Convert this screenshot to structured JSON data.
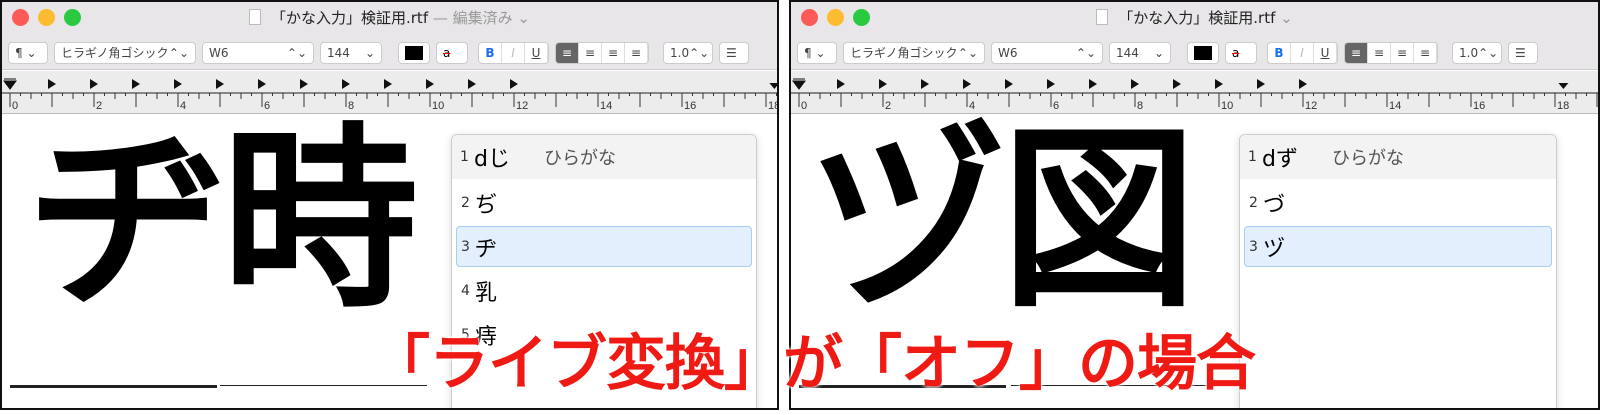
{
  "colors": {
    "close": "#fc5b57",
    "minimize": "#fdbb2f",
    "zoom": "#29c940",
    "overlay": "#f01a14",
    "selection": "#e3effd"
  },
  "windows": [
    {
      "title": "「かな入力」検証用.rtf",
      "edited": "— 編集済み ⌄",
      "toolbar": {
        "paragraph": "¶ ⌄",
        "font": "ヒラギノ角ゴシック",
        "font_arrow": "⌃⌄",
        "weight": "W6",
        "size": "144",
        "size_arrow": "⌄",
        "bold": "B",
        "italic": "I",
        "underline": "U",
        "spacing": "1.0",
        "list": "☰"
      },
      "doc_text": "ヂ時",
      "candidates": {
        "input": "dじ",
        "mode": "ひらがな",
        "items": [
          {
            "n": "1"
          },
          {
            "n": "2",
            "t": "ぢ"
          },
          {
            "n": "3",
            "t": "ヂ"
          },
          {
            "n": "4",
            "t": "乳"
          },
          {
            "n": "5",
            "t": "痔"
          }
        ]
      }
    },
    {
      "title": "「かな入力」検証用.rtf",
      "edited": "⌄",
      "toolbar": {
        "paragraph": "¶ ⌄",
        "font": "ヒラギノ角ゴシック",
        "font_arrow": "⌃⌄",
        "weight": "W6",
        "size": "144",
        "size_arrow": "⌄",
        "bold": "B",
        "italic": "I",
        "underline": "U",
        "spacing": "1.0",
        "list": "☰"
      },
      "doc_text": "ヅ図",
      "candidates": {
        "input": "dず",
        "mode": "ひらがな",
        "items": [
          {
            "n": "1"
          },
          {
            "n": "2",
            "t": "づ"
          },
          {
            "n": "3",
            "t": "ヅ"
          }
        ]
      }
    }
  ],
  "ruler_labels": [
    "0",
    "2",
    "4",
    "6",
    "8",
    "10",
    "12",
    "14",
    "16",
    "18"
  ],
  "overlay": "「ライブ変換」が「オフ」の場合"
}
